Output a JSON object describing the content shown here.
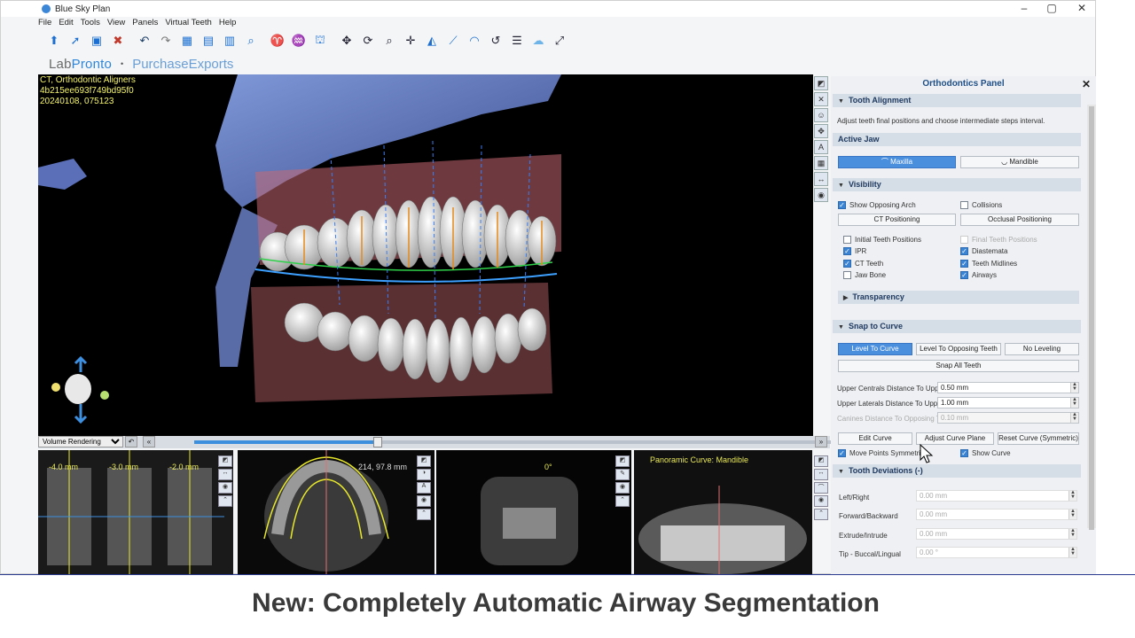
{
  "window": {
    "title": "Blue Sky Plan",
    "minimize": "–",
    "maximize": "▢",
    "close": "✕"
  },
  "menu": [
    "File",
    "Edit",
    "Tools",
    "View",
    "Panels",
    "Virtual Teeth",
    "Help"
  ],
  "brand": {
    "labpronto_a": "Lab",
    "labpronto_b": "Pronto",
    "separator": "•",
    "purchase_exports": "PurchaseExports"
  },
  "view3d": {
    "overlay_line1": "CT, Orthodontic Aligners",
    "overlay_line2": "4b215ee693f749bd95f0",
    "overlay_line3": "20240108, 075123",
    "render_mode": "Volume Rendering"
  },
  "slider": {
    "position_fraction": 0.28
  },
  "panes": {
    "slice1": "-4.0 mm",
    "slice2": "-3.0 mm",
    "slice3": "-2.0 mm",
    "axial_coord": "214, 97.8 mm",
    "coronal_angle": "0°",
    "pano_title": "Panoramic Curve: Mandible"
  },
  "panel": {
    "title": "Orthodontics Panel",
    "close": "✕",
    "tooth_alignment": {
      "header": "Tooth Alignment",
      "desc": "Adjust teeth final positions and choose intermediate steps interval."
    },
    "active_jaw": {
      "header": "Active Jaw",
      "maxilla": "Maxilla",
      "mandible": "Mandible"
    },
    "visibility": {
      "header": "Visibility",
      "show_opposing_arch": "Show Opposing Arch",
      "collisions": "Collisions",
      "ct_positioning": "CT Positioning",
      "occlusal_positioning": "Occlusal Positioning",
      "initial_teeth_positions": "Initial Teeth Positions",
      "final_teeth_positions": "Final Teeth Positions",
      "ipr": "IPR",
      "diastemata": "Diastemata",
      "ct_teeth": "CT Teeth",
      "teeth_midlines": "Teeth Midlines",
      "jaw_bone": "Jaw Bone",
      "airways": "Airways"
    },
    "transparency": {
      "header": "Transparency"
    },
    "snap_to_curve": {
      "header": "Snap to Curve",
      "level_to_curve": "Level To Curve",
      "level_to_opposing": "Level To Opposing Teeth",
      "no_leveling": "No Leveling",
      "snap_all": "Snap All Teeth",
      "upper_centrals_label": "Upper Centrals Distance To Upper Curve",
      "upper_centrals_value": "0.50 mm",
      "upper_laterals_label": "Upper Laterals Distance To Upper Curve",
      "upper_laterals_value": "1.00 mm",
      "canines_label": "Canines Distance To Opposing Teeth",
      "canines_value": "0.10 mm",
      "edit_curve": "Edit Curve",
      "adjust_curve_plane": "Adjust Curve Plane",
      "reset_curve": "Reset Curve (Symmetric)",
      "move_points_symmetric": "Move Points Symmetric",
      "show_curve": "Show Curve"
    },
    "tooth_deviations": {
      "header": "Tooth Deviations (-)",
      "rows": [
        {
          "label": "Left/Right",
          "value": "0.00 mm"
        },
        {
          "label": "Forward/Backward",
          "value": "0.00 mm"
        },
        {
          "label": "Extrude/Intrude",
          "value": "0.00 mm"
        },
        {
          "label": "Tip - Buccal/Lingual",
          "value": "0.00 °"
        }
      ]
    }
  },
  "caption": "New: Completely Automatic Airway Segmentation",
  "colors": {
    "accent": "#4a8fde",
    "overlay_text": "#f3f36a",
    "caption_text": "#3a3a3a"
  }
}
